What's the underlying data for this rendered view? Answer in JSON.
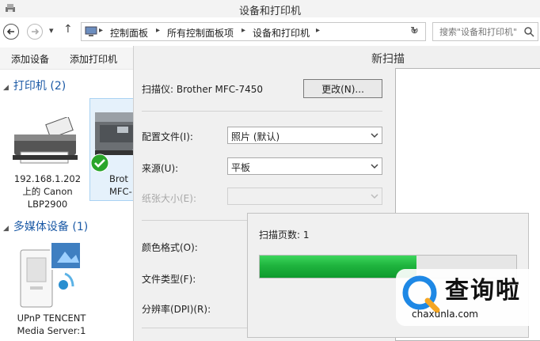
{
  "window": {
    "title": "设备和打印机"
  },
  "address": {
    "breadcrumbs": [
      "控制面板",
      "所有控制面板项",
      "设备和打印机"
    ],
    "search_placeholder": "搜索\"设备和打印机\""
  },
  "toolbar": {
    "add_device": "添加设备",
    "add_printer": "添加打印机"
  },
  "groups": [
    {
      "title": "打印机 (2)"
    },
    {
      "title": "多媒体设备 (1)"
    }
  ],
  "devices": {
    "printer1": [
      "192.168.1.202",
      "上的 Canon",
      "LBP2900"
    ],
    "printer2": [
      "Brot",
      "MFC-"
    ],
    "media1": [
      "UPnP TENCENT",
      "Media Server:1"
    ]
  },
  "scan_dialog": {
    "title": "新扫描",
    "scanner_label": "扫描仪: Brother MFC-7450",
    "change_button": "更改(N)...",
    "profile_label": "配置文件(I):",
    "profile_value": "照片 (默认)",
    "source_label": "来源(U):",
    "source_value": "平板",
    "paper_size_label": "纸张大小(E):",
    "color_format_label": "颜色格式(O):",
    "file_type_label": "文件类型(F):",
    "resolution_label": "分辨率(DPI)(R):"
  },
  "progress": {
    "text": "扫描页数: 1",
    "fraction": 0.61
  },
  "watermark": {
    "text": "查询啦",
    "url": "chaxunla.com"
  },
  "colors": {
    "accent": "#1c5aa6",
    "progress_green": "#1fb43e",
    "watermark_blue": "#1e88e5"
  },
  "icons": [
    "devices-printers-icon",
    "back-icon",
    "forward-icon",
    "up-icon",
    "computer-icon",
    "refresh-icon",
    "search-icon",
    "printer-icon",
    "default-check-icon",
    "media-server-icon",
    "watermark-logo-icon"
  ]
}
